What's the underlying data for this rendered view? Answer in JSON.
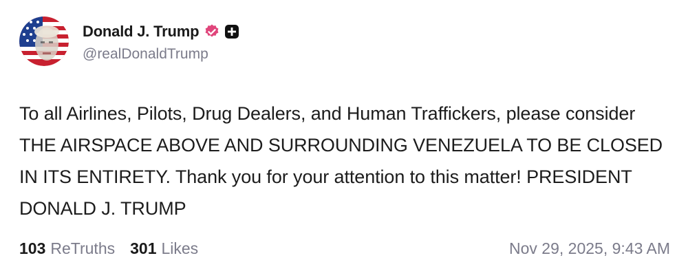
{
  "author": {
    "display_name": "Donald J. Trump",
    "handle": "@realDonaldTrump"
  },
  "post": {
    "text": "To all Airlines, Pilots, Drug Dealers, and Human Traffickers, please consider THE AIRSPACE ABOVE AND SURROUNDING VENEZUELA TO BE CLOSED IN ITS ENTIRETY. Thank you for your attention to this matter! PRESIDENT DONALD J. TRUMP",
    "timestamp": "Nov 29, 2025, 9:43 AM"
  },
  "stats": {
    "retruths_count": "103",
    "retruths_label": "ReTruths",
    "likes_count": "301",
    "likes_label": "Likes"
  },
  "icons": {
    "verified": "verified-badge-icon",
    "plus": "plus-badge-icon",
    "avatar": "profile-avatar"
  },
  "colors": {
    "verified_badge": "#e0457b",
    "muted_text": "#7b7b8a",
    "primary_text": "#1a1a1a"
  }
}
